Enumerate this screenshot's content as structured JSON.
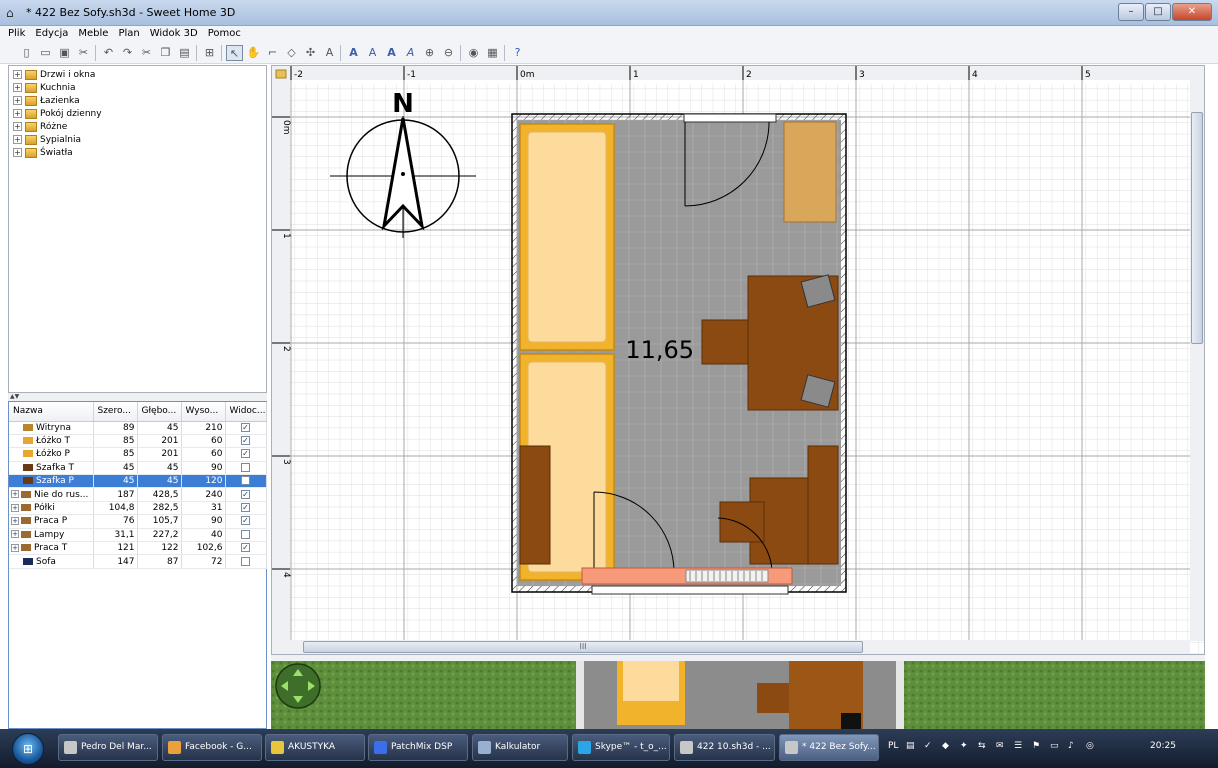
{
  "window": {
    "title": "* 422 Bez Sofy.sh3d - Sweet Home 3D",
    "minimize_label": "–",
    "maximize_label": "□",
    "close_label": "✕"
  },
  "menu": [
    "Plik",
    "Edycja",
    "Meble",
    "Plan",
    "Widok 3D",
    "Pomoc"
  ],
  "toolbar_icons": [
    "new-file-icon",
    "open-icon",
    "save-icon",
    "preferences-icon",
    "undo-icon",
    "redo-icon",
    "cut-icon",
    "copy-icon",
    "paste-icon",
    "add-furniture-icon",
    "select-mode-icon",
    "pan-mode-icon",
    "create-walls-icon",
    "create-rooms-icon",
    "create-dimensions-icon",
    "create-labels-icon",
    "increase-text-icon",
    "decrease-text-icon",
    "bold-text-icon",
    "italic-text-icon",
    "zoom-in-icon",
    "zoom-out-icon",
    "photo-icon",
    "video-icon",
    "help-icon"
  ],
  "catalog": {
    "categories": [
      "Drzwi i okna",
      "Kuchnia",
      "Łazienka",
      "Pokój dzienny",
      "Różne",
      "Sypialnia",
      "Światła"
    ]
  },
  "furniture_table": {
    "columns": [
      "Nazwa",
      "Szero...",
      "Głębo...",
      "Wyso...",
      "Widoc..."
    ],
    "rows": [
      {
        "name": "Witryna",
        "w": "89",
        "d": "45",
        "h": "210",
        "visible": true,
        "group": false,
        "color": "#b8862a"
      },
      {
        "name": "Łóżko T",
        "w": "85",
        "d": "201",
        "h": "60",
        "visible": true,
        "group": false,
        "color": "#e8a530"
      },
      {
        "name": "Łóżko P",
        "w": "85",
        "d": "201",
        "h": "60",
        "visible": true,
        "group": false,
        "color": "#e8a530"
      },
      {
        "name": "Szafka T",
        "w": "45",
        "d": "45",
        "h": "90",
        "visible": false,
        "group": false,
        "color": "#6a3a12"
      },
      {
        "name": "Szafka P",
        "w": "45",
        "d": "45",
        "h": "120",
        "visible": false,
        "group": false,
        "color": "#6a3a12",
        "selected": true
      },
      {
        "name": "Nie do rus...",
        "w": "187",
        "d": "428,5",
        "h": "240",
        "visible": true,
        "group": true,
        "color": "#9c6a30"
      },
      {
        "name": "Półki",
        "w": "104,8",
        "d": "282,5",
        "h": "31",
        "visible": true,
        "group": true,
        "color": "#9c6a30"
      },
      {
        "name": "Praca P",
        "w": "76",
        "d": "105,7",
        "h": "90",
        "visible": true,
        "group": true,
        "color": "#9c6a30"
      },
      {
        "name": "Lampy",
        "w": "31,1",
        "d": "227,2",
        "h": "40",
        "visible": false,
        "group": true,
        "color": "#9c6a30"
      },
      {
        "name": "Praca T",
        "w": "121",
        "d": "122",
        "h": "102,6",
        "visible": true,
        "group": true,
        "color": "#9c6a30"
      },
      {
        "name": "Sofa",
        "w": "147",
        "d": "87",
        "h": "72",
        "visible": false,
        "group": false,
        "color": "#1c2c5a"
      }
    ]
  },
  "plan": {
    "ruler_top": [
      "-2",
      "-1",
      "0m",
      "1",
      "2",
      "3",
      "4",
      "5"
    ],
    "ruler_left": [
      "0m",
      "1",
      "2",
      "3",
      "4"
    ],
    "compass_label": "N",
    "room_area": "11,65 m²",
    "scroll_grip": "III"
  },
  "colors": {
    "selection": "#3c7ed6",
    "floor": "#9a9a9a",
    "bed_frame": "#f2b32c",
    "bed_mattress": "#fddb9c",
    "desk": "#8b4a12",
    "wardrobe": "#d9a75a"
  },
  "taskbar": {
    "start_label": "⊞",
    "items": [
      {
        "label": "Pedro Del Mar...",
        "icon_color": "#c7c7c7"
      },
      {
        "label": "Facebook - G...",
        "icon_color": "#e9a23b"
      },
      {
        "label": "AKUSTYKA",
        "icon_color": "#e9c53b"
      },
      {
        "label": "PatchMix DSP",
        "icon_color": "#3b6fe9"
      },
      {
        "label": "Kalkulator",
        "icon_color": "#9ab0d0"
      },
      {
        "label": "Skype™ - t_o_...",
        "icon_color": "#2aa6e6"
      },
      {
        "label": "422 10.sh3d - ...",
        "icon_color": "#c7c7c7"
      },
      {
        "label": "* 422 Bez Sofy...",
        "icon_color": "#c7c7c7",
        "active": true
      }
    ],
    "language": "PL",
    "clock": "20:25"
  }
}
